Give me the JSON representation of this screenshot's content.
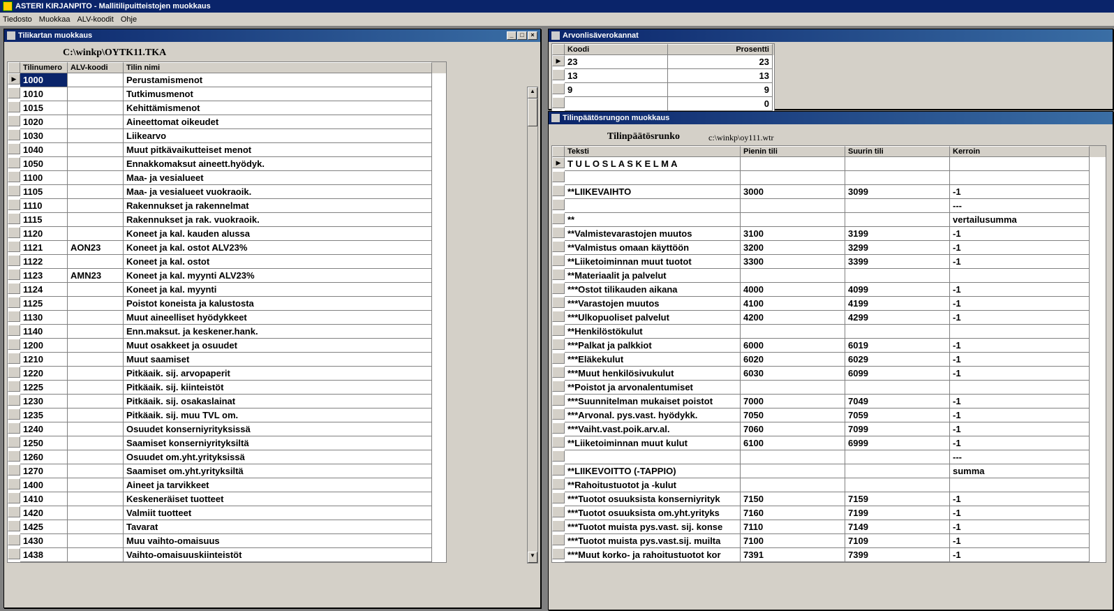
{
  "app": {
    "title": "ASTERI KIRJANPITO - Mallitilipuitteistojen muokkaus"
  },
  "menu": {
    "m1": "Tiedosto",
    "m2": "Muokkaa",
    "m3": "ALV-koodit",
    "m4": "Ohje"
  },
  "win1": {
    "title": "Tilikartan muokkaus",
    "path": "C:\\winkp\\OYTK11.TKA",
    "headers": {
      "h1": "Tilinumero",
      "h2": "ALV-koodi",
      "h3": "Tilin nimi"
    },
    "rows": [
      {
        "num": "1000",
        "alv": "",
        "name": "Perustamismenot"
      },
      {
        "num": "1010",
        "alv": "",
        "name": "Tutkimusmenot"
      },
      {
        "num": "1015",
        "alv": "",
        "name": "Kehittämismenot"
      },
      {
        "num": "1020",
        "alv": "",
        "name": "Aineettomat oikeudet"
      },
      {
        "num": "1030",
        "alv": "",
        "name": "Liikearvo"
      },
      {
        "num": "1040",
        "alv": "",
        "name": "Muut pitkävaikutteiset menot"
      },
      {
        "num": "1050",
        "alv": "",
        "name": "Ennakkomaksut aineett.hyödyk."
      },
      {
        "num": "1100",
        "alv": "",
        "name": "Maa- ja vesialueet"
      },
      {
        "num": "1105",
        "alv": "",
        "name": "Maa- ja vesialueet vuokraoik."
      },
      {
        "num": "1110",
        "alv": "",
        "name": "Rakennukset ja rakennelmat"
      },
      {
        "num": "1115",
        "alv": "",
        "name": "Rakennukset ja rak. vuokraoik."
      },
      {
        "num": "1120",
        "alv": "",
        "name": "Koneet ja kal. kauden alussa"
      },
      {
        "num": "1121",
        "alv": "AON23",
        "name": "Koneet ja kal. ostot ALV23%"
      },
      {
        "num": "1122",
        "alv": "",
        "name": "Koneet ja kal. ostot"
      },
      {
        "num": "1123",
        "alv": "AMN23",
        "name": "Koneet ja kal. myynti ALV23%"
      },
      {
        "num": "1124",
        "alv": "",
        "name": "Koneet ja kal. myynti"
      },
      {
        "num": "1125",
        "alv": "",
        "name": "Poistot koneista ja kalustosta"
      },
      {
        "num": "1130",
        "alv": "",
        "name": "Muut aineelliset hyödykkeet"
      },
      {
        "num": "1140",
        "alv": "",
        "name": "Enn.maksut. ja keskener.hank."
      },
      {
        "num": "1200",
        "alv": "",
        "name": "Muut osakkeet ja osuudet"
      },
      {
        "num": "1210",
        "alv": "",
        "name": "Muut saamiset"
      },
      {
        "num": "1220",
        "alv": "",
        "name": "Pitkäaik. sij. arvopaperit"
      },
      {
        "num": "1225",
        "alv": "",
        "name": "Pitkäaik. sij. kiinteistöt"
      },
      {
        "num": "1230",
        "alv": "",
        "name": "Pitkäaik. sij. osakaslainat"
      },
      {
        "num": "1235",
        "alv": "",
        "name": "Pitkäaik. sij. muu TVL om."
      },
      {
        "num": "1240",
        "alv": "",
        "name": "Osuudet konserniyrityksissä"
      },
      {
        "num": "1250",
        "alv": "",
        "name": "Saamiset konserniyrityksiltä"
      },
      {
        "num": "1260",
        "alv": "",
        "name": "Osuudet om.yht.yrityksissä"
      },
      {
        "num": "1270",
        "alv": "",
        "name": "Saamiset om.yht.yrityksiltä"
      },
      {
        "num": "1400",
        "alv": "",
        "name": "Aineet ja tarvikkeet"
      },
      {
        "num": "1410",
        "alv": "",
        "name": "Keskeneräiset tuotteet"
      },
      {
        "num": "1420",
        "alv": "",
        "name": "Valmiit tuotteet"
      },
      {
        "num": "1425",
        "alv": "",
        "name": "Tavarat"
      },
      {
        "num": "1430",
        "alv": "",
        "name": "Muu vaihto-omaisuus"
      },
      {
        "num": "1438",
        "alv": "",
        "name": "Vaihto-omaisuuskiinteistöt"
      }
    ]
  },
  "win2": {
    "title": "Arvonlisäverokannat",
    "headers": {
      "h1": "Koodi",
      "h2": "Prosentti"
    },
    "rows": [
      {
        "k": "23",
        "p": "23"
      },
      {
        "k": "13",
        "p": "13"
      },
      {
        "k": "9",
        "p": "9"
      },
      {
        "k": "",
        "p": "0"
      }
    ]
  },
  "win3": {
    "title": "Tilinpäätösrungon muokkaus",
    "label": "Tilinpäätösrunko",
    "path": "c:\\winkp\\oy111.wtr",
    "headers": {
      "h1": "Teksti",
      "h2": "Pienin tili",
      "h3": "Suurin tili",
      "h4": "Kerroin"
    },
    "rows": [
      {
        "t": "T U L O S L A S K E L M A",
        "a": "",
        "b": "",
        "k": ""
      },
      {
        "t": "",
        "a": "",
        "b": "",
        "k": ""
      },
      {
        "t": "**LIIKEVAIHTO",
        "a": "3000",
        "b": "3099",
        "k": "-1"
      },
      {
        "t": "",
        "a": "",
        "b": "",
        "k": "---"
      },
      {
        "t": "**",
        "a": "",
        "b": "",
        "k": "vertailusumma"
      },
      {
        "t": "**Valmistevarastojen muutos",
        "a": "3100",
        "b": "3199",
        "k": "-1"
      },
      {
        "t": "**Valmistus omaan käyttöön",
        "a": "3200",
        "b": "3299",
        "k": "-1"
      },
      {
        "t": "**Liiketoiminnan muut tuotot",
        "a": "3300",
        "b": "3399",
        "k": "-1"
      },
      {
        "t": "**Materiaalit ja palvelut",
        "a": "",
        "b": "",
        "k": ""
      },
      {
        "t": "***Ostot tilikauden aikana",
        "a": "4000",
        "b": "4099",
        "k": "-1"
      },
      {
        "t": "***Varastojen muutos",
        "a": "4100",
        "b": "4199",
        "k": "-1"
      },
      {
        "t": "***Ulkopuoliset palvelut",
        "a": "4200",
        "b": "4299",
        "k": "-1"
      },
      {
        "t": "**Henkilöstökulut",
        "a": "",
        "b": "",
        "k": ""
      },
      {
        "t": "***Palkat ja palkkiot",
        "a": "6000",
        "b": "6019",
        "k": "-1"
      },
      {
        "t": "***Eläkekulut",
        "a": "6020",
        "b": "6029",
        "k": "-1"
      },
      {
        "t": "***Muut henkilösivukulut",
        "a": "6030",
        "b": "6099",
        "k": "-1"
      },
      {
        "t": "**Poistot ja arvonalentumiset",
        "a": "",
        "b": "",
        "k": ""
      },
      {
        "t": "***Suunnitelman mukaiset poistot",
        "a": "7000",
        "b": "7049",
        "k": "-1"
      },
      {
        "t": "***Arvonal. pys.vast. hyödykk.",
        "a": "7050",
        "b": "7059",
        "k": "-1"
      },
      {
        "t": "***Vaiht.vast.poik.arv.al.",
        "a": "7060",
        "b": "7099",
        "k": "-1"
      },
      {
        "t": "**Liiketoiminnan muut kulut",
        "a": "6100",
        "b": "6999",
        "k": "-1"
      },
      {
        "t": "",
        "a": "",
        "b": "",
        "k": "---"
      },
      {
        "t": "**LIIKEVOITTO (-TAPPIO)",
        "a": "",
        "b": "",
        "k": "summa"
      },
      {
        "t": "**Rahoitustuotot ja -kulut",
        "a": "",
        "b": "",
        "k": ""
      },
      {
        "t": "***Tuotot osuuksista konserniyrityk",
        "a": "7150",
        "b": "7159",
        "k": "-1"
      },
      {
        "t": "***Tuotot osuuksista om.yht.yrityks",
        "a": "7160",
        "b": "7199",
        "k": "-1"
      },
      {
        "t": "***Tuotot muista pys.vast. sij. konse",
        "a": "7110",
        "b": "7149",
        "k": "-1"
      },
      {
        "t": "***Tuotot muista pys.vast.sij. muilta",
        "a": "7100",
        "b": "7109",
        "k": "-1"
      },
      {
        "t": "***Muut korko- ja rahoitustuotot kor",
        "a": "7391",
        "b": "7399",
        "k": "-1"
      }
    ]
  }
}
